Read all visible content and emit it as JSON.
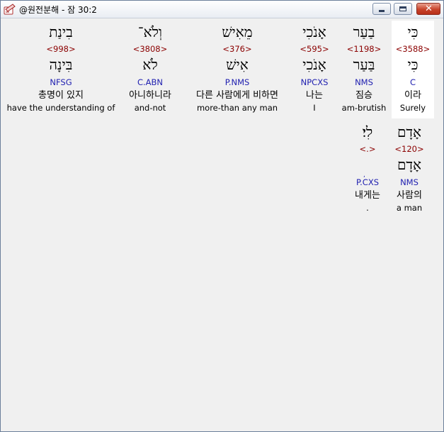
{
  "window": {
    "title": "@원전분해 - 잠 30:2",
    "app_icon": "app-icon",
    "controls": {
      "minimize": "minimize-icon",
      "maximize": "maximize-icon",
      "close": "close-icon"
    }
  },
  "words": [
    {
      "hebrew": "כִּי",
      "strong": "<3588>",
      "lemma": "כִּי",
      "grammar": "C",
      "korean": "이라",
      "english": "Surely",
      "selected": true
    },
    {
      "hebrew": "בַעַר",
      "strong": "<1198>",
      "lemma": "בַּעַר",
      "grammar": "NMS",
      "korean": "짐승",
      "english": "am-brutish"
    },
    {
      "hebrew": "אָנֹכִי",
      "strong": "<595>",
      "lemma": "אָנֹכִי",
      "grammar": "NPCXS",
      "korean": "나는",
      "english": "I"
    },
    {
      "hebrew": "מֵאִישׁ",
      "strong": "<376>",
      "lemma": "אִישׁ",
      "grammar": "P.NMS",
      "korean": "다른 사람에게 비하면",
      "english": "more-than any man"
    },
    {
      "hebrew": "וְלֹא־",
      "strong": "<3808>",
      "lemma": "לֹא",
      "grammar": "C.ABN",
      "korean": "아니하니라",
      "english": "and-not"
    },
    {
      "hebrew": "בִינַת",
      "strong": "<998>",
      "lemma": "בִּינָה",
      "grammar": "NFSG",
      "korean": "총명이 있지",
      "english": "have the understanding of"
    },
    {
      "hebrew": "אָדָם",
      "strong": "<120>",
      "lemma": "אָדָם",
      "grammar": "NMS",
      "korean": "사람의",
      "english": "a man"
    },
    {
      "hebrew": "לִי׃",
      "strong": "<.>",
      "lemma": "",
      "grammar": "P.CXS",
      "korean": "내게는",
      "english": "."
    }
  ]
}
